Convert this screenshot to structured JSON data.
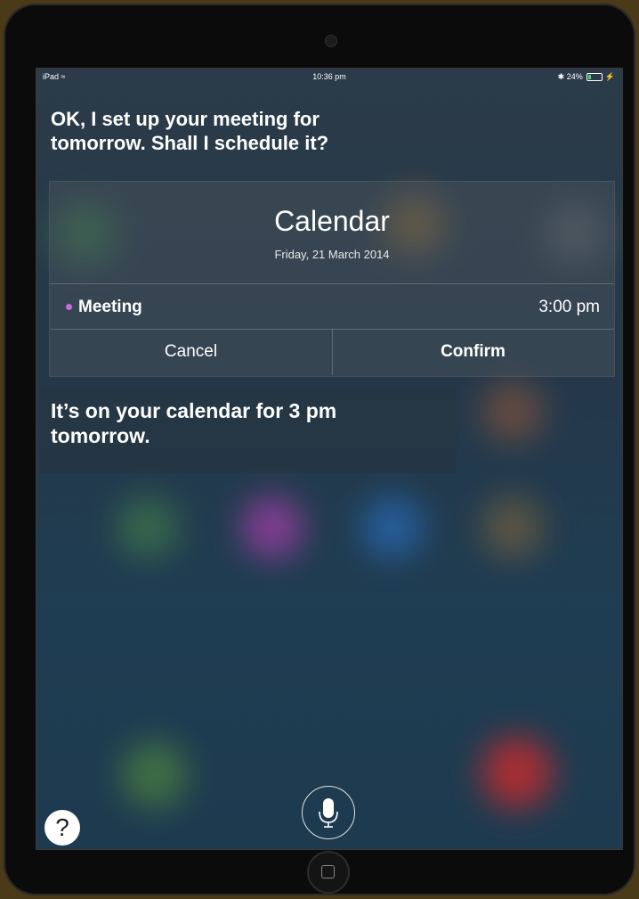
{
  "statusbar": {
    "device": "iPad",
    "time": "10:36 pm",
    "battery": "24%",
    "battery_level": 0.24
  },
  "siri": {
    "prompt_line1": "OK, I set up your meeting for",
    "prompt_line2": "tomorrow. Shall I schedule it?",
    "reply_line1": "It’s on your calendar for 3 pm",
    "reply_line2": "tomorrow."
  },
  "calendar_card": {
    "title": "Calendar",
    "date": "Friday, 21 March 2014",
    "event": {
      "name": "Meeting",
      "time": "3:00 pm",
      "dot_color": "#c86be0"
    },
    "buttons": {
      "cancel": "Cancel",
      "confirm": "Confirm"
    }
  },
  "controls": {
    "help_label": "?",
    "mic_icon": "microphone-icon",
    "home_icon": "home-button-icon"
  }
}
